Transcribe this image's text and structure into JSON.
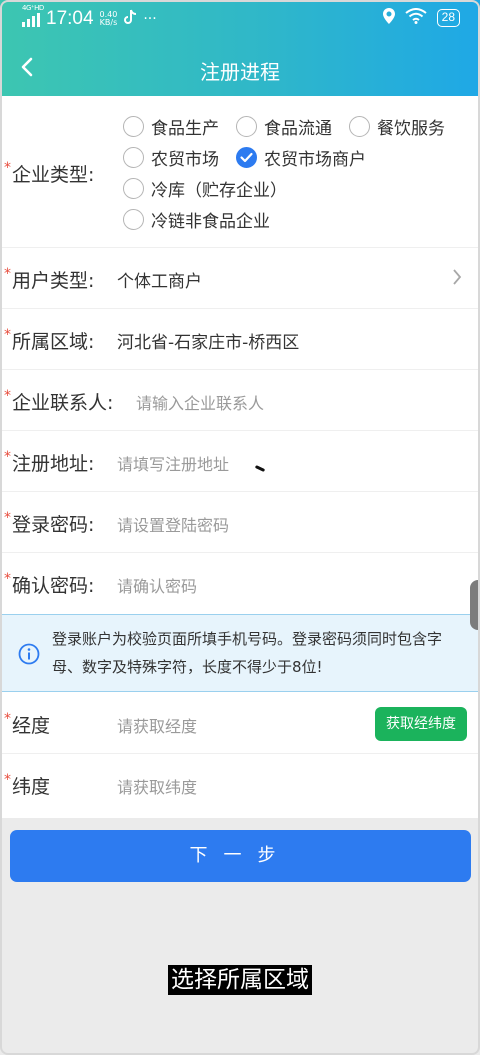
{
  "status_bar": {
    "network_label": "4G⁺HD",
    "time": "17:04",
    "net_speed_value": "0.40",
    "net_speed_unit": "KB/s",
    "notifications": "···",
    "battery": "28"
  },
  "nav": {
    "title": "注册进程"
  },
  "enterprise_type": {
    "label": "企业类型:",
    "options": [
      {
        "label": "食品生产",
        "selected": false
      },
      {
        "label": "食品流通",
        "selected": false
      },
      {
        "label": "餐饮服务",
        "selected": false
      },
      {
        "label": "农贸市场",
        "selected": false
      },
      {
        "label": "农贸市场商户",
        "selected": true
      },
      {
        "label": "冷库（贮存企业）",
        "selected": false
      },
      {
        "label": "冷链非食品企业",
        "selected": false
      }
    ]
  },
  "user_type": {
    "label": "用户类型:",
    "value": "个体工商户"
  },
  "region": {
    "label": "所属区域:",
    "value": "河北省-石家庄市-桥西区"
  },
  "contact": {
    "label": "企业联系人:",
    "placeholder": "请输入企业联系人"
  },
  "address": {
    "label": "注册地址:",
    "placeholder": "请填写注册地址"
  },
  "password": {
    "label": "登录密码:",
    "placeholder": "请设置登陆密码"
  },
  "confirm_password": {
    "label": "确认密码:",
    "placeholder": "请确认密码"
  },
  "tip": {
    "text": "登录账户为校验页面所填手机号码。登录密码须同时包含字母、数字及特殊字符，长度不得少于8位!"
  },
  "longitude": {
    "label": "经度",
    "placeholder": "请获取经度",
    "button": "获取经纬度"
  },
  "latitude": {
    "label": "纬度",
    "placeholder": "请获取纬度"
  },
  "next_button": "下一步",
  "caption": "选择所属区域",
  "colors": {
    "accent_blue": "#2d7bf0",
    "green_button": "#1bb35c",
    "required_star": "#e74c3c"
  }
}
